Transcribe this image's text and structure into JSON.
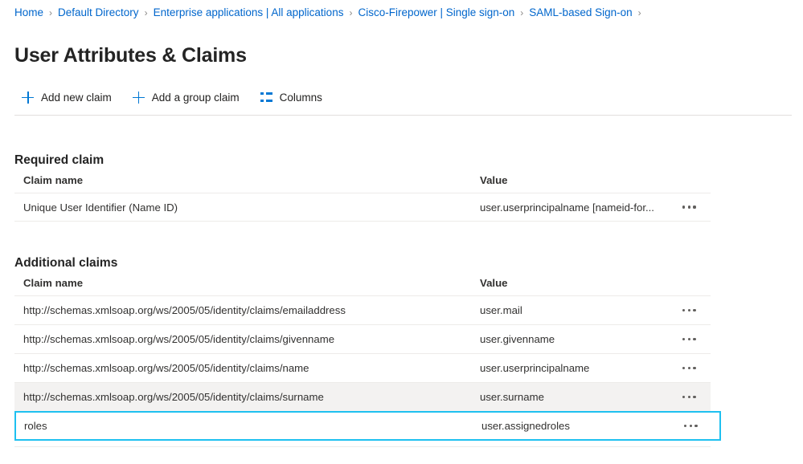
{
  "breadcrumb": {
    "separator": "›",
    "items": [
      {
        "label": "Home"
      },
      {
        "label": "Default Directory"
      },
      {
        "label": "Enterprise applications | All applications"
      },
      {
        "label": "Cisco-Firepower | Single sign-on"
      },
      {
        "label": "SAML-based Sign-on"
      }
    ]
  },
  "page": {
    "title": "User Attributes & Claims"
  },
  "toolbar": {
    "add_new_claim": "Add new claim",
    "add_group_claim": "Add a group claim",
    "columns": "Columns",
    "icons": {
      "add_new_claim": "plus-icon",
      "add_group_claim": "plus-icon",
      "columns": "columns-icon"
    }
  },
  "required_section": {
    "heading": "Required claim",
    "columns": {
      "name": "Claim name",
      "value": "Value"
    },
    "rows": [
      {
        "name": "Unique User Identifier (Name ID)",
        "value": "user.userprincipalname [nameid-for...",
        "state": "default"
      }
    ]
  },
  "additional_section": {
    "heading": "Additional claims",
    "columns": {
      "name": "Claim name",
      "value": "Value"
    },
    "rows": [
      {
        "name": "http://schemas.xmlsoap.org/ws/2005/05/identity/claims/emailaddress",
        "value": "user.mail",
        "state": "default"
      },
      {
        "name": "http://schemas.xmlsoap.org/ws/2005/05/identity/claims/givenname",
        "value": "user.givenname",
        "state": "default"
      },
      {
        "name": "http://schemas.xmlsoap.org/ws/2005/05/identity/claims/name",
        "value": "user.userprincipalname",
        "state": "default"
      },
      {
        "name": "http://schemas.xmlsoap.org/ws/2005/05/identity/claims/surname",
        "value": "user.surname",
        "state": "hovered"
      },
      {
        "name": "roles",
        "value": "user.assignedroles",
        "state": "focused"
      }
    ]
  },
  "colors": {
    "link": "#0066cc",
    "accent": "#0078d4",
    "focus_border": "#1ec0f0",
    "hover_row": "#f3f2f1",
    "divider": "#edebe9",
    "text": "#323130"
  }
}
